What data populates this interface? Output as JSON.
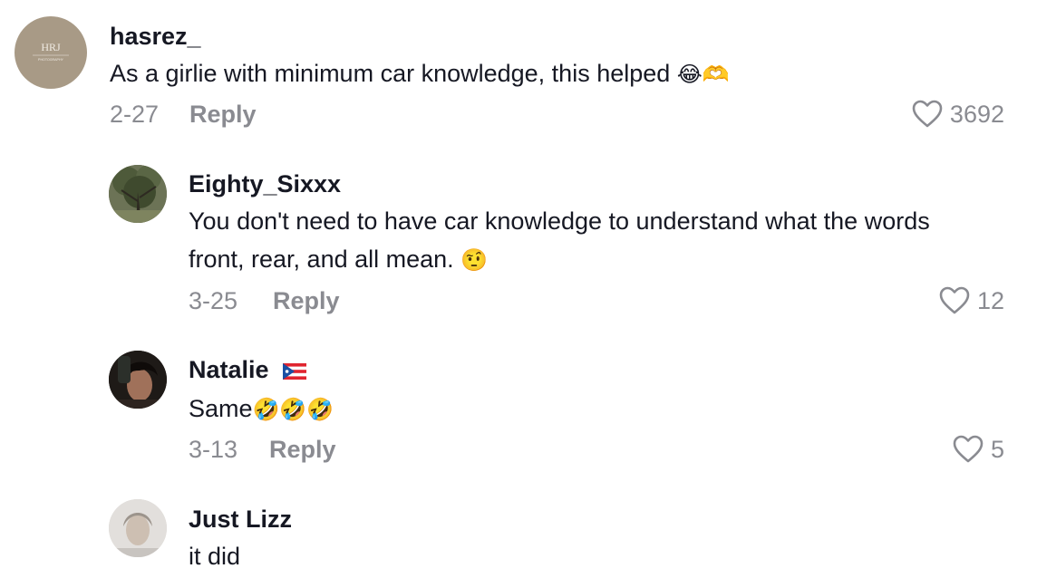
{
  "comments": [
    {
      "username": "hasrez_",
      "avatar_text": "HRJ",
      "avatar_subtext": "PHOTOGRAPHY",
      "text": "As a girlie with minimum car knowledge, this helped",
      "text_emoji": "😂🫶",
      "date": "2-27",
      "reply_label": "Reply",
      "likes": "3692"
    },
    {
      "username": "Eighty_Sixxx",
      "text_line1": "You don't need to have car knowledge to understand what the words",
      "text_line2": "front, rear, and all mean.",
      "text_emoji": "🤨",
      "date": "3-25",
      "reply_label": "Reply",
      "likes": "12"
    },
    {
      "username": "Natalie",
      "username_flag": "puerto-rico-flag",
      "text": "Same",
      "text_emoji": "🤣🤣🤣",
      "date": "3-13",
      "reply_label": "Reply",
      "likes": "5"
    },
    {
      "username": "Just Lizz",
      "text": "it did"
    }
  ],
  "colors": {
    "primary_text": "#161823",
    "secondary_text": "#8a8b91",
    "avatar_beige": "#a89a86"
  }
}
